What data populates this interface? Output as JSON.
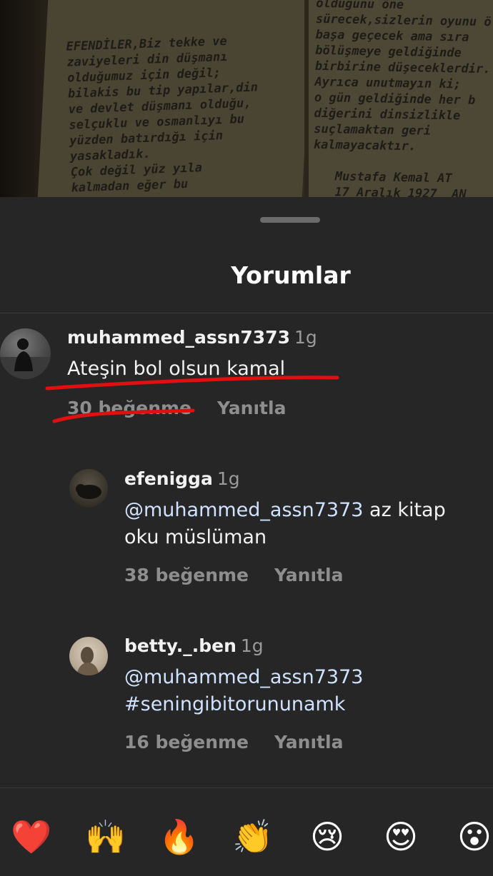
{
  "background_photo": {
    "left_lines": [
      "EFENDİLER,Biz tekke ve",
      "zaviyeleri din düşmanı",
      "olduğumuz için değil;",
      "bilakis bu tip yapılar,din",
      "ve devlet düşmanı olduğu,",
      "selçuklu ve osmanlıyı bu",
      "yüzden batırdığı için",
      "yasakladık.",
      "Çok değil yüz yıla",
      "kalmadan eğer bu"
    ],
    "right_lines": [
      "olduğunu öne",
      "sürecek,sizlerin oyunu ö",
      "başa geçecek ama sıra",
      "bölüşmeye geldiğinde",
      "birbirine düşeceklerdir.",
      "Ayrıca unutmayın ki;",
      "o gün geldiğinde her b",
      "diğerini dinsizlikle",
      "suçlamaktan geri",
      "kalmayacaktır.",
      "",
      "   Mustafa Kemal AT",
      "   17 Aralık 1927  AN"
    ]
  },
  "sheet": {
    "title": "Yorumlar"
  },
  "comments": [
    {
      "username": "muhammed_assn7373",
      "time": "1g",
      "text": "Ateşin bol olsun kamal",
      "likes": "30 beğenme",
      "reply": "Yanıtla"
    },
    {
      "username": "efenigga",
      "time": "1g",
      "mention": "@muhammed_assn7373",
      "text_line1_rest": " az kitap",
      "text_line2": "oku müslüman",
      "likes": "38 beğenme",
      "reply": "Yanıtla"
    },
    {
      "username": "betty._.ben",
      "time": "1g",
      "mention": "@muhammed_assn7373",
      "text_line2": "#seningibitorununamk",
      "likes": "16 beğenme",
      "reply": "Yanıtla"
    }
  ],
  "emoji_bar": [
    {
      "glyph": "❤️",
      "icon": "red-heart-icon"
    },
    {
      "glyph": "🙌",
      "icon": "raising-hands-icon"
    },
    {
      "glyph": "🔥",
      "icon": "fire-icon"
    },
    {
      "glyph": "👏",
      "icon": "clapping-hands-icon"
    },
    {
      "glyph": "😢",
      "icon": "crying-face-icon"
    },
    {
      "glyph": "😍",
      "icon": "heart-eyes-icon"
    },
    {
      "glyph": "😮",
      "icon": "surprised-face-icon"
    }
  ],
  "colors": {
    "sheet_bg": "#262626",
    "text": "#f2f2f2",
    "muted": "#8e8e8e",
    "annotation_red": "#e01010"
  }
}
